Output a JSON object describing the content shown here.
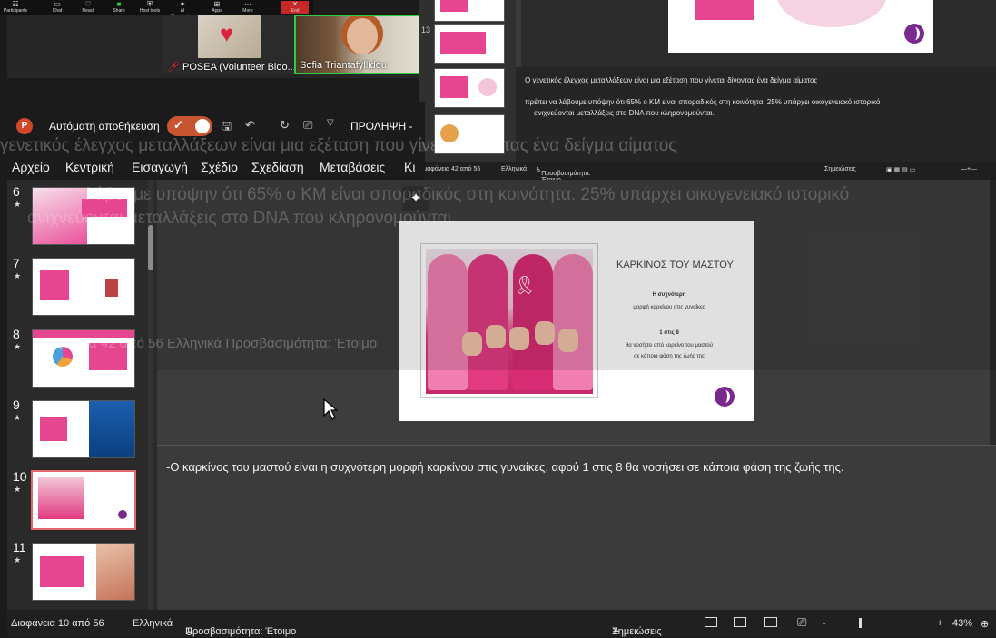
{
  "zoom": {
    "toolbar": [
      "Participants",
      "Chat",
      "React",
      "Share",
      "Host tools",
      "AI Companion",
      "Apps",
      "More",
      "End"
    ],
    "tiles": [
      {
        "name": "POSEA (Volunteer Bloo...",
        "muted": true
      },
      {
        "name": "Sofia Triantafyllidou",
        "muted": false
      }
    ]
  },
  "shared_window": {
    "notes_line1": "Ο γενετικός έλεγχος μεταλλάξεων είναι μια εξέταση που γίνεται δίνοντας ένα δείγμα αίματος",
    "notes_line2": "πρέπει να λάβουμε υπόψην ότι 65% ο ΚΜ είναι σποραδικός στη κοινότητα. 25% υπάρχει οικογενειακό ιστορικό",
    "notes_line3": "ανιχνεύονται μεταλλάξεις στο DNA που κληρονομούνται.",
    "status_slide": "Διαφάνεια 42 από 56",
    "status_lang": "Ελληνικά",
    "status_access": "Προσβασιμότητα: Έτοιμο",
    "status_notes": "Σημειώσεις",
    "thumb_number": "13"
  },
  "ghost_text": {
    "line1": "γενετικός έλεγχος μεταλλάξεων είναι μια εξέταση που γίνεται δίνοντας ένα δείγμα αίματος",
    "line2": "λάβουμε υπόψην ότι 65% ο ΚΜ είναι σποραδικός στη κοινότητα. 25% υπάρχει οικογενειακό ιστορικό",
    "line3": "ανιχνεύονται μεταλλάξεις στο DNA που κληρονομούνται.",
    "line4": "Διαφάνεια 42 από 56   Ελληνικά   Προσβασιμότητα: Έτοιμο"
  },
  "titlebar": {
    "logo": "P",
    "autosave_label": "Αυτόματη αποθήκευση",
    "autosave_on": true,
    "doc_title": "ΠΡΟΛΗΨΗ -"
  },
  "menu": [
    "Αρχείο",
    "Κεντρική",
    "Εισαγωγή",
    "Σχέδιο",
    "Σχεδίαση",
    "Μεταβάσεις",
    "Κι"
  ],
  "thumbnails": [
    {
      "number": "6"
    },
    {
      "number": "7"
    },
    {
      "number": "8"
    },
    {
      "number": "9"
    },
    {
      "number": "10",
      "selected": true
    },
    {
      "number": "11"
    }
  ],
  "slide": {
    "title": "ΚΑΡΚΙΝΟΣ ΤΟΥ ΜΑΣΤΟΥ",
    "text1": "Η συχνότερη",
    "text2": "μορφή καρκίνου στις γυναίκες",
    "text3": "1 στις 8",
    "text4": "θα νοσήσει από καρκίνο του μαστού",
    "text5": "σε κάποια φάση της ζωής της"
  },
  "notes": "-Ο καρκίνος του μαστού είναι η συχνότερη μορφή καρκίνου στις γυναίκες, αφού 1 στις 8 θα νοσήσει σε κάποια φάση της ζωής της.",
  "statusbar": {
    "slide_info": "Διαφάνεια 10 από 56",
    "language": "Ελληνικά",
    "accessibility": "Προσβασιμότητα: Έτοιμο",
    "notes_button": "Σημειώσεις",
    "zoom_minus": "-",
    "zoom_plus": "+",
    "zoom_level": "43%"
  },
  "colors": {
    "accent": "#e5468f",
    "autosave": "#c8552f",
    "logo": "#7a2a8e"
  }
}
